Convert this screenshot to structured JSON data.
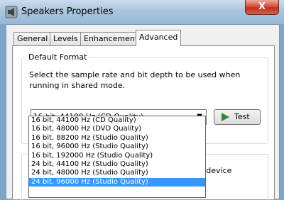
{
  "window": {
    "title": "Speakers Properties",
    "close_label": "X"
  },
  "tabs": [
    {
      "label": "General"
    },
    {
      "label": "Levels"
    },
    {
      "label": "Enhancements"
    },
    {
      "label": "Advanced"
    }
  ],
  "default_format": {
    "group_label": "Default Format",
    "description": "Select the sample rate and bit depth to be used when running in shared mode.",
    "selected_value": "16 bit, 44100 Hz (CD Quality)",
    "test_label": "Test",
    "options": [
      "16 bit, 44100 Hz (CD Quality)",
      "16 bit, 48000 Hz (DVD Quality)",
      "16 bit, 88200 Hz (Studio Quality)",
      "16 bit, 96000 Hz (Studio Quality)",
      "16 bit, 192000 Hz (Studio Quality)",
      "24 bit, 44100 Hz (Studio Quality)",
      "24 bit, 48000 Hz (Studio Quality)",
      "24 bit, 96000 Hz (Studio Quality)"
    ],
    "highlighted_index": 7
  },
  "exclusive_mode": {
    "group_label": "E",
    "partial_text": "his device"
  },
  "colors": {
    "selection": "#3399ff",
    "close_button": "#c1301c",
    "test_icon": "#2f8a2f"
  }
}
